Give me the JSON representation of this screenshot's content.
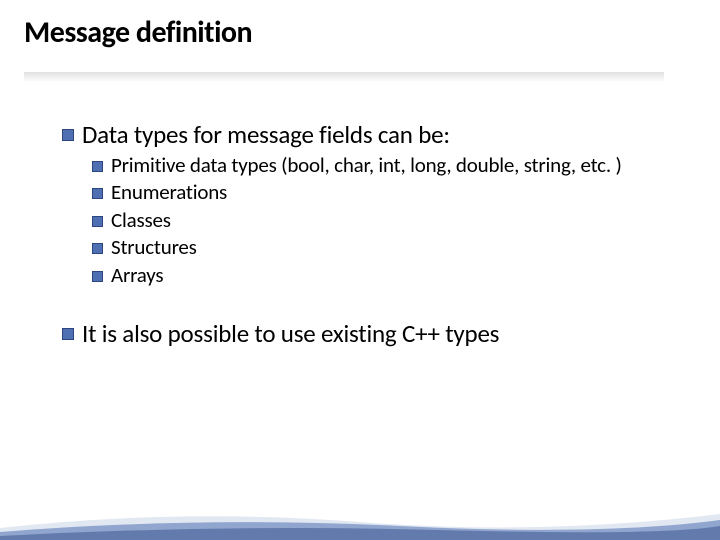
{
  "title": "Message definition",
  "bullets": {
    "l1_0": "Data types for message fields can be:",
    "l2_0": "Primitive data types (bool, char, int, long, double, string, etc. )",
    "l2_1": "Enumerations",
    "l2_2": "Classes",
    "l2_3": "Structures",
    "l2_4": "Arrays",
    "l1_1": "It is also possible to use existing C++ types"
  }
}
